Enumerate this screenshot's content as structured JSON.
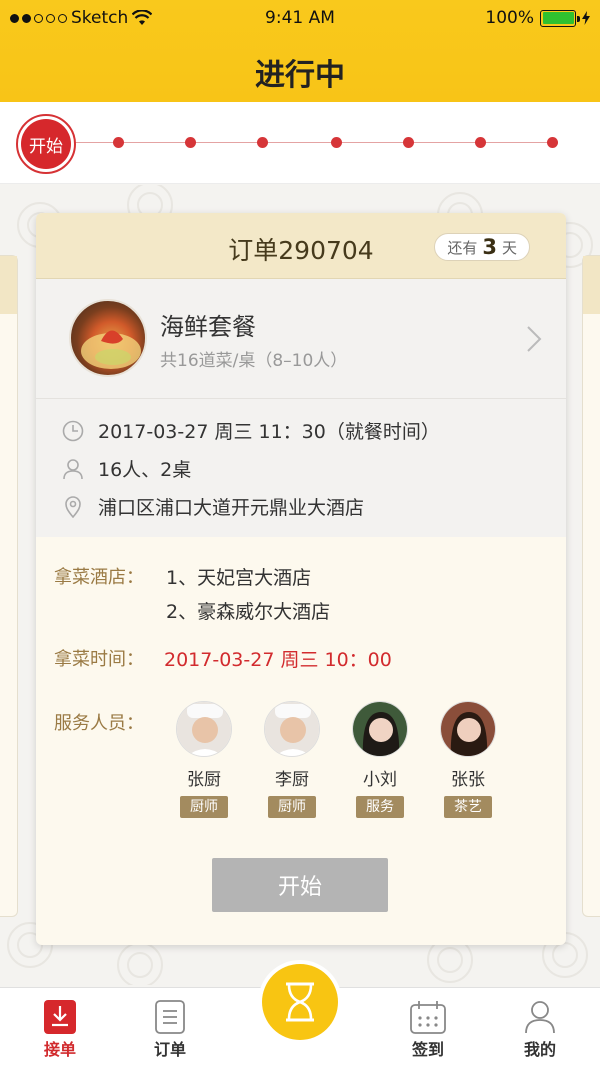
{
  "status_bar": {
    "carrier": "Sketch",
    "time": "9:41 AM",
    "battery": "100%"
  },
  "header": {
    "title": "进行中"
  },
  "progress": {
    "start_label": "开始",
    "step_count": 7
  },
  "order": {
    "number": "订单290704",
    "remaining_prefix": "还有",
    "remaining_value": "3",
    "remaining_unit": "天",
    "dish": {
      "name": "海鲜套餐",
      "desc": "共16道菜/桌（8–10人）"
    },
    "time": "2017-03-27  周三 11：30（就餐时间）",
    "people": "16人、2桌",
    "address": "浦口区浦口大道开元鼎业大酒店",
    "pickup_hotels_label": "拿菜酒店：",
    "hotels": [
      "1、天妃宫大酒店",
      "2、豪森威尔大酒店"
    ],
    "pickup_time_label": "拿菜时间：",
    "pickup_time": "2017-03-27  周三 10：00",
    "staff_label": "服务人员：",
    "staff": [
      {
        "name": "张厨",
        "role": "厨师"
      },
      {
        "name": "李厨",
        "role": "厨师"
      },
      {
        "name": "小刘",
        "role": "服务"
      },
      {
        "name": "张张",
        "role": "茶艺"
      }
    ],
    "start_button": "开始"
  },
  "tabbar": {
    "items": [
      {
        "label": "接单",
        "icon": "download-icon"
      },
      {
        "label": "订单",
        "icon": "list-icon"
      },
      {
        "label": "签到",
        "icon": "calendar-icon"
      },
      {
        "label": "我的",
        "icon": "user-icon"
      }
    ],
    "center_icon": "hourglass-icon"
  },
  "colors": {
    "brand_yellow": "#f8c512",
    "accent_red": "#d12a2d",
    "gold": "#a38b5f"
  }
}
